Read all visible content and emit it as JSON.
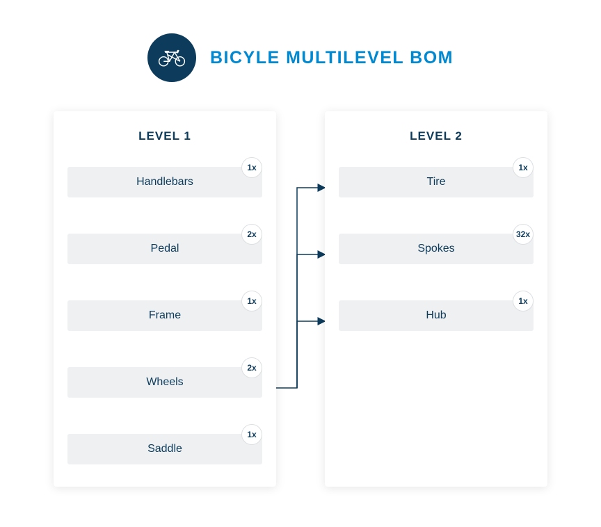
{
  "header": {
    "title": "BICYLE MULTILEVEL BOM",
    "iconName": "bicycle-icon"
  },
  "levels": [
    {
      "title": "LEVEL 1",
      "items": [
        {
          "label": "Handlebars",
          "qty": "1x"
        },
        {
          "label": "Pedal",
          "qty": "2x"
        },
        {
          "label": "Frame",
          "qty": "1x"
        },
        {
          "label": "Wheels",
          "qty": "2x"
        },
        {
          "label": "Saddle",
          "qty": "1x"
        }
      ]
    },
    {
      "title": "LEVEL 2",
      "items": [
        {
          "label": "Tire",
          "qty": "1x"
        },
        {
          "label": "Spokes",
          "qty": "32x"
        },
        {
          "label": "Hub",
          "qty": "1x"
        }
      ]
    }
  ],
  "colors": {
    "darkNavy": "#0c3b5c",
    "brandBlue": "#0088d1",
    "itemBg": "#eff0f1"
  }
}
